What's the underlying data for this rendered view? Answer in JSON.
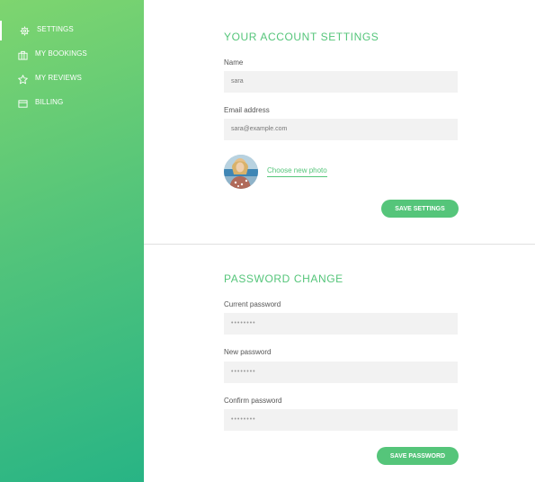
{
  "sidebar": {
    "items": [
      {
        "label": "SETTINGS",
        "icon": "gear-icon",
        "active": true
      },
      {
        "label": "MY BOOKINGS",
        "icon": "briefcase-icon",
        "active": false
      },
      {
        "label": "MY REVIEWS",
        "icon": "star-icon",
        "active": false
      },
      {
        "label": "BILLING",
        "icon": "credit-card-icon",
        "active": false
      }
    ]
  },
  "account": {
    "title": "YOUR ACCOUNT SETTINGS",
    "name_label": "Name",
    "name_value": "sara",
    "email_label": "Email address",
    "email_value": "sara@example.com",
    "photo_link": "Choose new photo",
    "save_label": "SAVE SETTINGS"
  },
  "password": {
    "title": "PASSWORD CHANGE",
    "current_label": "Current password",
    "current_value": "••••••••",
    "new_label": "New password",
    "new_value": "••••••••",
    "confirm_label": "Confirm password",
    "confirm_value": "••••••••",
    "save_label": "SAVE PASSWORD"
  },
  "colors": {
    "accent": "#55c57a",
    "sidebar_gradient_start": "#7ed56f",
    "sidebar_gradient_end": "#28b485",
    "input_bg": "#f2f2f2"
  }
}
